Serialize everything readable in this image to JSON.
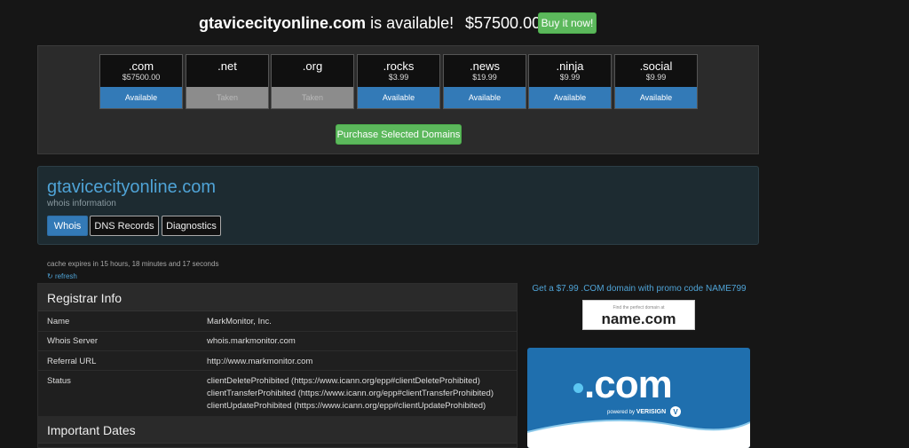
{
  "banner": {
    "domain": "gtavicecityonline.com",
    "available_text": " is available!",
    "price": "$57500.00",
    "buy_label": "Buy it now!"
  },
  "tlds": [
    {
      "name": ".com",
      "price": "$57500.00",
      "status": "Available",
      "state": "available"
    },
    {
      "name": ".net",
      "price": "",
      "status": "Taken",
      "state": "taken"
    },
    {
      "name": ".org",
      "price": "",
      "status": "Taken",
      "state": "taken"
    },
    {
      "name": ".rocks",
      "price": "$3.99",
      "status": "Available",
      "state": "available"
    },
    {
      "name": ".news",
      "price": "$19.99",
      "status": "Available",
      "state": "available"
    },
    {
      "name": ".ninja",
      "price": "$9.99",
      "status": "Available",
      "state": "available"
    },
    {
      "name": ".social",
      "price": "$9.99",
      "status": "Available",
      "state": "available"
    }
  ],
  "purchase_label": "Purchase Selected Domains",
  "domain_panel": {
    "title": "gtavicecityonline.com",
    "subtitle": "whois information",
    "tabs": [
      {
        "label": "Whois",
        "active": true
      },
      {
        "label": "DNS Records",
        "active": false
      },
      {
        "label": "Diagnostics",
        "active": false
      }
    ]
  },
  "cache_text": "cache expires in 15 hours, 18 minutes and 17 seconds",
  "refresh_label": "refresh",
  "registrar": {
    "heading": "Registrar Info",
    "rows": [
      {
        "label": "Name",
        "value": [
          "MarkMonitor, Inc."
        ]
      },
      {
        "label": "Whois Server",
        "value": [
          "whois.markmonitor.com"
        ]
      },
      {
        "label": "Referral URL",
        "value": [
          "http://www.markmonitor.com"
        ]
      },
      {
        "label": "Status",
        "value": [
          "clientDeleteProhibited (https://www.icann.org/epp#clientDeleteProhibited)",
          "clientTransferProhibited (https://www.icann.org/epp#clientTransferProhibited)",
          "clientUpdateProhibited (https://www.icann.org/epp#clientUpdateProhibited)"
        ]
      }
    ]
  },
  "dates_heading": "Important Dates",
  "sidebar": {
    "promo_text": "Get a $7.99 .COM domain with promo code NAME799",
    "namecom_tagline": "Find the perfect domain at",
    "namecom_brand": "name.com",
    "verisign_big": ".com",
    "verisign_powered": "powered by",
    "verisign_brand": "VERISIGN"
  },
  "colors": {
    "accent_blue": "#337ab7",
    "link_blue": "#4fa3d6",
    "success_green": "#5cb85c"
  }
}
